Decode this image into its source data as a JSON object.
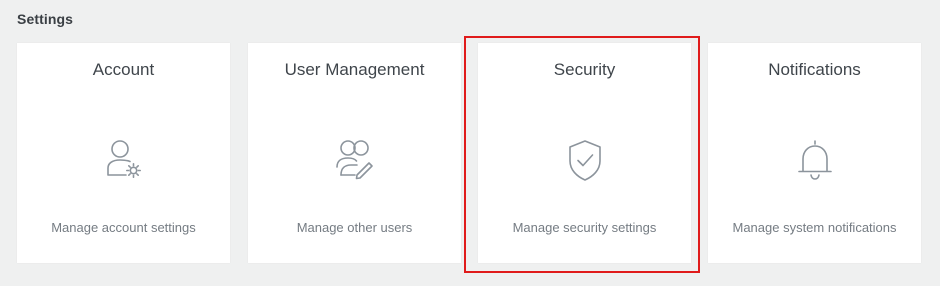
{
  "settings": {
    "heading": "Settings",
    "cards": [
      {
        "title": "Account",
        "description": "Manage account settings",
        "icon": "account-settings-icon"
      },
      {
        "title": "User Management",
        "description": "Manage other users",
        "icon": "users-edit-icon"
      },
      {
        "title": "Security",
        "description": "Manage security settings",
        "icon": "shield-check-icon"
      },
      {
        "title": "Notifications",
        "description": "Manage system notifications",
        "icon": "bell-icon"
      }
    ],
    "highlight_color": "#e01b1b",
    "icon_color": "#8c949c"
  }
}
